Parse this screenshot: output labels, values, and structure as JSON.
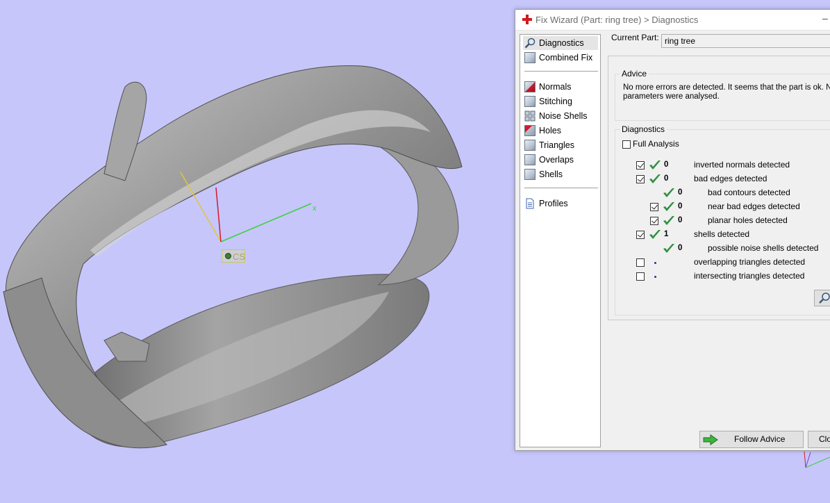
{
  "viewport": {
    "coordinate_system_label": "CS",
    "colors": {
      "background": "#c6c6fb",
      "model": "#8c8c8c",
      "axis_x": "#3ad03a",
      "axis_y": "#e3c53a",
      "axis_z": "#d21a2a"
    }
  },
  "dialog": {
    "title": "Fix Wizard (Part: ring tree) > Diagnostics",
    "minimize_glyph": "–",
    "nav": {
      "top_items": [
        {
          "label": "Diagnostics",
          "icon": "magnifier-icon",
          "selected": true
        },
        {
          "label": "Combined Fix",
          "icon": "cube-icon",
          "selected": false
        }
      ],
      "fix_items": [
        {
          "label": "Normals",
          "icon": "normals-cube-icon"
        },
        {
          "label": "Stitching",
          "icon": "stitching-cube-icon"
        },
        {
          "label": "Noise Shells",
          "icon": "noise-shells-icon"
        },
        {
          "label": "Holes",
          "icon": "holes-cube-icon"
        },
        {
          "label": "Triangles",
          "icon": "triangles-cube-icon"
        },
        {
          "label": "Overlaps",
          "icon": "overlaps-cube-icon"
        },
        {
          "label": "Shells",
          "icon": "shells-cube-icon"
        }
      ],
      "bottom_items": [
        {
          "label": "Profiles",
          "icon": "document-icon"
        }
      ]
    },
    "current_part": {
      "label": "Current Part:",
      "value": "ring tree"
    },
    "advice": {
      "title": "Advice",
      "line1": "No more errors are detected. It seems that the part is ok. Not",
      "line2": "parameters were analysed."
    },
    "diagnostics": {
      "title": "Diagnostics",
      "full_analysis_label": "Full Analysis",
      "full_analysis_checked": false,
      "rows": [
        {
          "checkbox": true,
          "checked": true,
          "status": "ok",
          "count": "0",
          "label": "inverted normals detected",
          "indent": 0
        },
        {
          "checkbox": true,
          "checked": true,
          "status": "ok",
          "count": "0",
          "label": "bad edges detected",
          "indent": 0
        },
        {
          "checkbox": false,
          "checked": false,
          "status": "ok",
          "count": "0",
          "label": "bad contours detected",
          "indent": 1
        },
        {
          "checkbox": true,
          "checked": true,
          "status": "ok",
          "count": "0",
          "label": "near bad edges detected",
          "indent": 1
        },
        {
          "checkbox": true,
          "checked": true,
          "status": "ok",
          "count": "0",
          "label": "planar holes detected",
          "indent": 1
        },
        {
          "checkbox": true,
          "checked": true,
          "status": "ok",
          "count": "1",
          "label": "shells detected",
          "indent": 0
        },
        {
          "checkbox": false,
          "checked": false,
          "status": "ok",
          "count": "0",
          "label": "possible noise shells detected",
          "indent": 1
        },
        {
          "checkbox": true,
          "checked": false,
          "status": "none",
          "count": "",
          "label": "overlapping triangles detected",
          "indent": 0
        },
        {
          "checkbox": true,
          "checked": false,
          "status": "none",
          "count": "",
          "label": "intersecting triangles detected",
          "indent": 0
        }
      ]
    },
    "buttons": {
      "follow_advice": "Follow Advice",
      "close": "Clos"
    }
  }
}
